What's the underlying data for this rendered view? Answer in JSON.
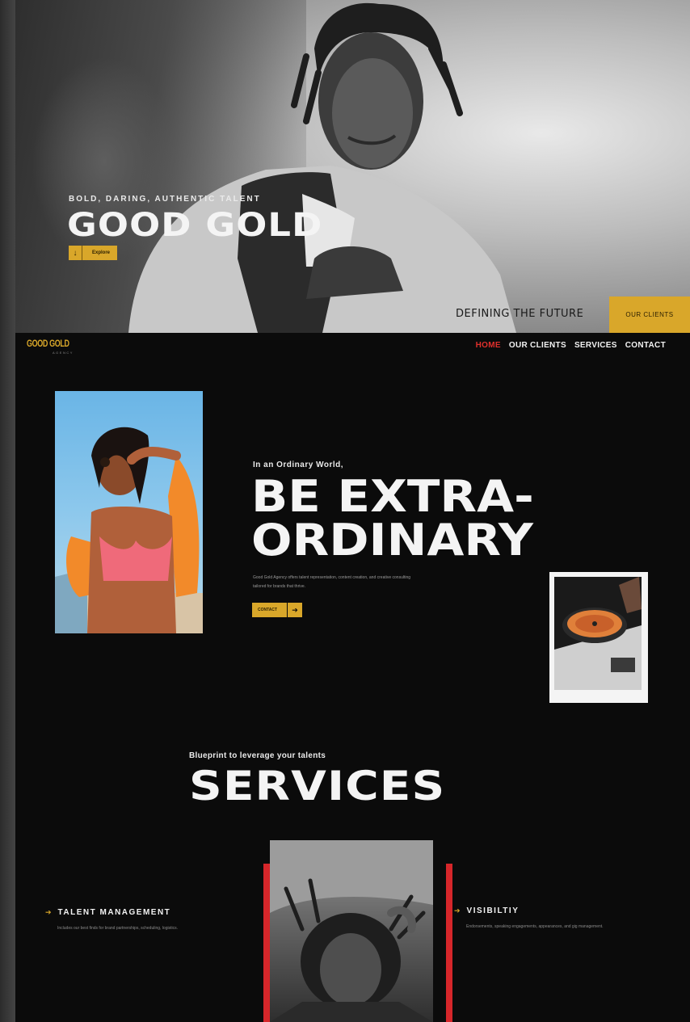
{
  "colors": {
    "gold": "#d9a72a",
    "red": "#e0302c",
    "dark": "#0b0b0b",
    "white": "#f4f4f4"
  },
  "hero": {
    "eyebrow": "BOLD, DARING, AUTHENTIC TALENT",
    "title": "GOOD GOLD",
    "explore_label": "Explore",
    "explore_icon": "arrow-down-icon",
    "tagline": "DEFINING THE FUTURE",
    "clients_cta": "OUR CLIENTS"
  },
  "nav": {
    "logo": "GOOD GOLD",
    "logo_sub": "AGENCY",
    "items": [
      {
        "label": "HOME",
        "active": true
      },
      {
        "label": "OUR CLIENTS"
      },
      {
        "label": "SERVICES"
      },
      {
        "label": "CONTACT"
      }
    ]
  },
  "about": {
    "eyebrow": "In an Ordinary World,",
    "headline_line1": "BE EXTRA-",
    "headline_line2": "ORDINARY",
    "body_line1": "Good Gold Agency offers talent representation, content creation, and creative consulting",
    "body_line2": "tailored for brands that thrive.",
    "contact_label": "CONTACT",
    "contact_icon": "arrow-right-icon"
  },
  "services": {
    "eyebrow": "Blueprint to leverage your talents",
    "title": "SERVICES",
    "items": [
      {
        "name": "TALENT MANAGEMENT",
        "desc": "Includes our best finds for brand partnerships, scheduling, logistics."
      },
      {
        "name": "VISIBILTIY",
        "desc": "Endorsements, speaking engagements, appearances, and gig management."
      }
    ]
  }
}
